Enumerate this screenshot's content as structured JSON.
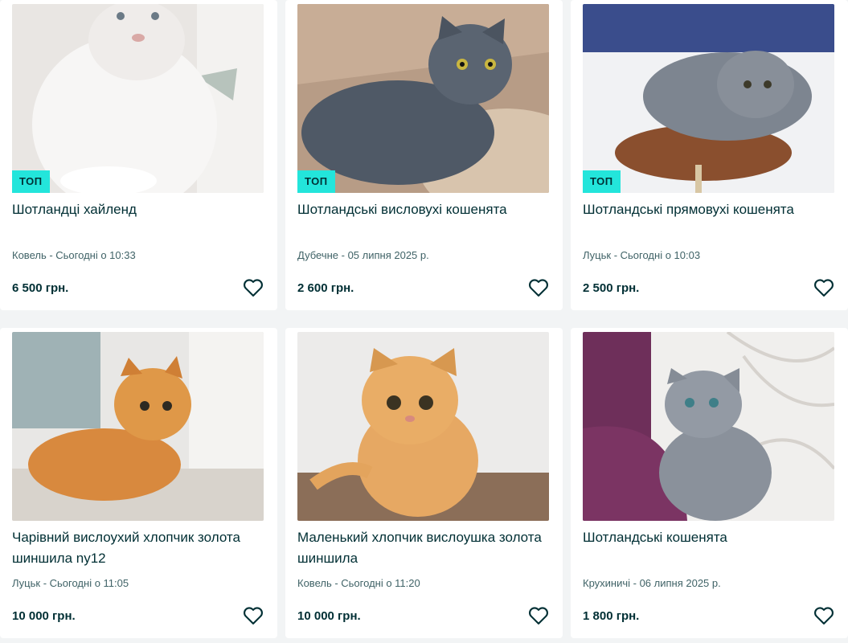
{
  "listings": [
    {
      "badge": "ТОП",
      "title": "Шотландці хайленд",
      "meta": "Ковель - Сьогодні о 10:33",
      "price": "6 500 грн.",
      "photo": "white fluffy kitten"
    },
    {
      "badge": "ТОП",
      "title": "Шотландські висловухі кошенята",
      "meta": "Дубечне - 05 липня 2025 р.",
      "price": "2 600 грн.",
      "photo": "grey fold kitten on blanket"
    },
    {
      "badge": "ТОП",
      "title": "Шотландські прямовухі кошенята",
      "meta": "Луцьк - Сьогодні о 10:03",
      "price": "2 500 грн.",
      "photo": "grey fluffy kitten on stool"
    },
    {
      "badge": "",
      "title": "Чарівний вислоухий хлопчик золота шиншила ny12",
      "meta": "Луцьк - Сьогодні о 11:05",
      "price": "10 000 грн.",
      "photo": "golden fold kitten lying"
    },
    {
      "badge": "",
      "title": "Маленький хлопчик вислоушка золота шиншила",
      "meta": "Ковель - Сьогодні о 11:20",
      "price": "10 000 грн.",
      "photo": "golden fold kitten sitting"
    },
    {
      "badge": "",
      "title": "Шотландські кошенята",
      "meta": "Крухиничі - 06 липня 2025 р.",
      "price": "1 800 грн.",
      "photo": "grey fold kitten on purple chair"
    }
  ],
  "icons": {
    "favorite": "heart-outline-icon"
  },
  "colors": {
    "badge_bg": "#23e5db",
    "text": "#002f34",
    "meta": "#406367",
    "page_bg": "#f2f4f5"
  }
}
